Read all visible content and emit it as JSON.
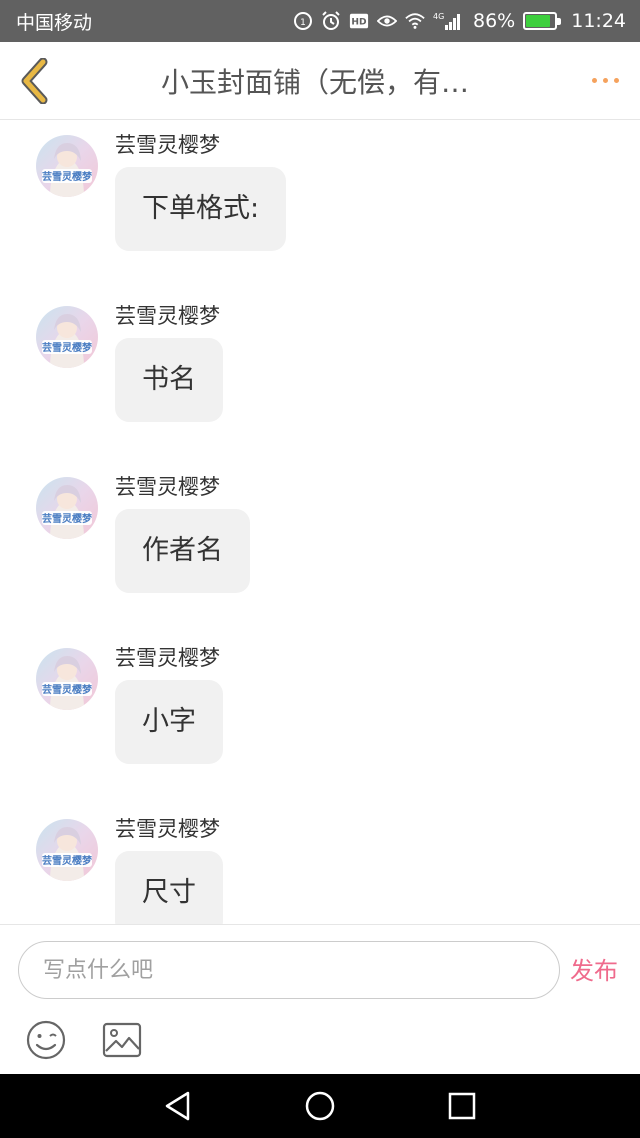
{
  "status_bar": {
    "carrier": "中国移动",
    "network": "4G",
    "battery_percent": "86%",
    "battery_level": 0.86,
    "time": "11:24",
    "background_color": "#616161"
  },
  "nav": {
    "title": "小玉封面铺（无偿，有…",
    "back_icon": "chevron-left-icon",
    "more_icon": "more-dots-icon",
    "back_icon_color": "#e8b844",
    "more_icon_color": "#f5a25d"
  },
  "messages": [
    {
      "sender": "芸雪灵樱梦",
      "text": "下单格式:"
    },
    {
      "sender": "芸雪灵樱梦",
      "text": "书名"
    },
    {
      "sender": "芸雪灵樱梦",
      "text": "作者名"
    },
    {
      "sender": "芸雪灵樱梦",
      "text": "小字"
    },
    {
      "sender": "芸雪灵樱梦",
      "text": "尺寸"
    }
  ],
  "input": {
    "placeholder": "写点什么吧",
    "send_label": "发布",
    "send_color": "#ef6a8c",
    "tools": [
      "emoji-icon",
      "image-icon"
    ]
  },
  "system_nav": [
    "back-triangle-icon",
    "home-circle-icon",
    "recents-square-icon"
  ]
}
